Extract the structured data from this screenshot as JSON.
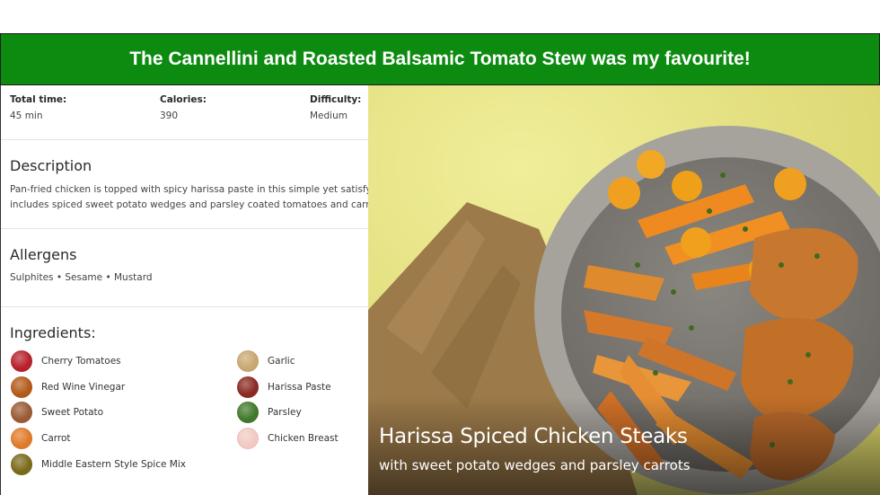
{
  "banner": {
    "text": "The Cannellini and Roasted Balsamic Tomato Stew was my favourite!",
    "color": "#0d8a10"
  },
  "stats": [
    {
      "label": "Total time:",
      "value": "45 min"
    },
    {
      "label": "Calories:",
      "value": "390"
    },
    {
      "label": "Difficulty:",
      "value": "Medium"
    }
  ],
  "description": {
    "heading": "Description",
    "line1": "Pan-fried chicken is topped with spicy harissa paste in this simple yet satisfying recip",
    "line2": "includes spiced sweet potato wedges and parsley coated tomatoes and carrots."
  },
  "allergens": {
    "heading": "Allergens",
    "text": "Sulphites • Sesame • Mustard"
  },
  "ingredients": {
    "heading": "Ingredients:",
    "items": [
      {
        "name": "Cherry Tomatoes",
        "icon": "cherry-tomatoes-icon",
        "color": "#b8202a"
      },
      {
        "name": "Garlic",
        "icon": "garlic-icon",
        "color": "#c8a870"
      },
      {
        "name": "Red Wine Vinegar",
        "icon": "red-wine-vinegar-icon",
        "color": "#b35a1a"
      },
      {
        "name": "Harissa Paste",
        "icon": "harissa-paste-icon",
        "color": "#8a2a22"
      },
      {
        "name": "Sweet Potato",
        "icon": "sweet-potato-icon",
        "color": "#9a5a35"
      },
      {
        "name": "Parsley",
        "icon": "parsley-icon",
        "color": "#3f7a2a"
      },
      {
        "name": "Carrot",
        "icon": "carrot-icon",
        "color": "#e07a2a"
      },
      {
        "name": "Chicken Breast",
        "icon": "chicken-breast-icon",
        "color": "#f1c9c2"
      },
      {
        "name": "Middle Eastern Style Spice Mix",
        "icon": "spice-mix-icon",
        "color": "#7a6a1a"
      }
    ]
  },
  "recipe": {
    "title": "Harissa Spiced Chicken Steaks",
    "subtitle": "with sweet potato wedges and parsley carrots"
  }
}
